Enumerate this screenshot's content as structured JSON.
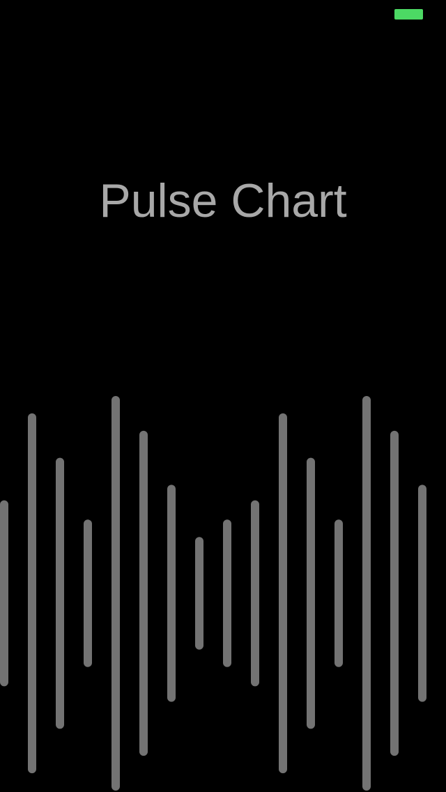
{
  "app": {
    "title": "Pulse Chart"
  },
  "status_bar": {
    "battery_color": "#4cd964"
  },
  "colors": {
    "background": "#000000",
    "title": "#a8a8a8",
    "bar": "#737373"
  },
  "chart_data": {
    "type": "bar",
    "title": "",
    "xlabel": "",
    "ylabel": "",
    "grid": false,
    "legend": "none",
    "baseline": "centered",
    "series": [
      {
        "values": [
          0.46,
          0.91,
          0.68,
          0.36,
          1.0,
          0.82,
          0.54,
          0.27,
          0.36,
          0.46,
          0.91,
          0.68,
          0.36,
          1.0,
          0.82,
          0.54
        ]
      }
    ]
  }
}
